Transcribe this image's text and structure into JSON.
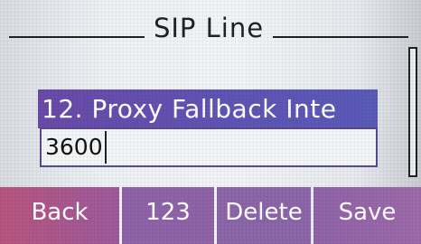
{
  "title": "SIP Line",
  "field": {
    "label": "12. Proxy Fallback Inte",
    "value": "3600"
  },
  "softkeys": {
    "back": "Back",
    "mode": "123",
    "delete": "Delete",
    "save": "Save"
  },
  "colors": {
    "highlight": "#5e55b5",
    "softkey": "#8f63a8",
    "screen_bg": "#eef1f4"
  }
}
